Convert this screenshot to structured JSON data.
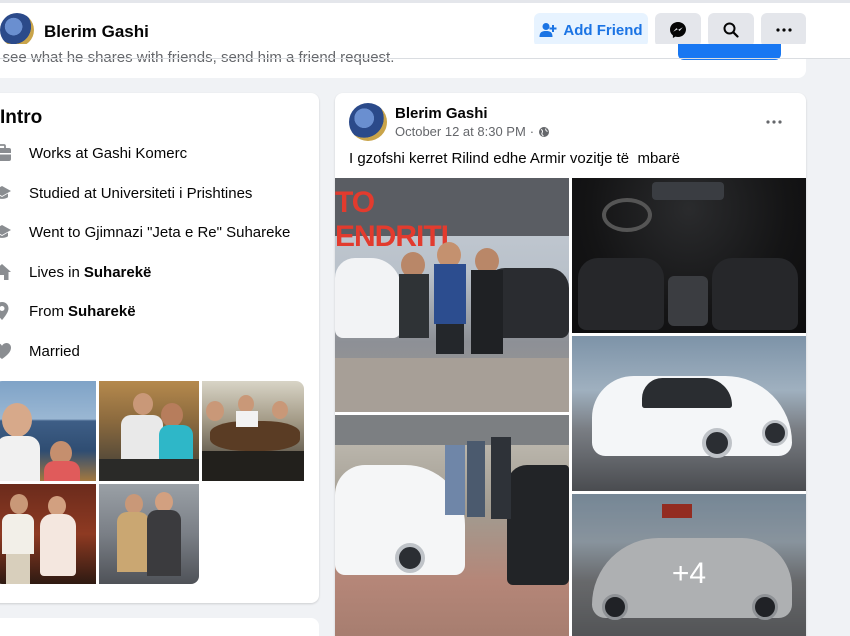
{
  "header": {
    "profile_name": "Blerim Gashi",
    "add_friend_label": "Add Friend",
    "hint_text": "o see what he shares with friends, send him a friend request."
  },
  "intro": {
    "title": "Intro",
    "items": [
      {
        "icon": "briefcase-icon",
        "text": "Works at Gashi Komerc",
        "bold": ""
      },
      {
        "icon": "graduation-cap-icon",
        "text": "Studied at Universiteti i Prishtines",
        "bold": ""
      },
      {
        "icon": "graduation-cap-icon",
        "text": "Went to Gjimnazi \"Jeta e Re\" Suhareke",
        "bold": ""
      },
      {
        "icon": "home-icon",
        "text": "Lives in",
        "bold": "Suharekë"
      },
      {
        "icon": "location-pin-icon",
        "text": "From",
        "bold": "Suharekë"
      },
      {
        "icon": "heart-icon",
        "text": "Married",
        "bold": ""
      }
    ]
  },
  "post": {
    "author": "Blerim Gashi",
    "timestamp": "October 12 at 8:30 PM",
    "separator": "·",
    "text": "I gzofshi kerret Rilind edhe Armir vozitje të  mbarë",
    "more_photos": "+4",
    "sign_text": "TO ENDRITI"
  }
}
